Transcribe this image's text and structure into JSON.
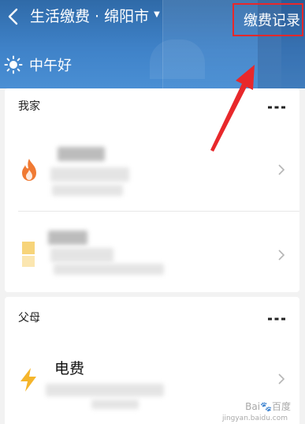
{
  "header": {
    "title": "生活缴费 · 绵阳市",
    "record_label": "缴费记录",
    "greeting": "中午好"
  },
  "groups": [
    {
      "title": "我家",
      "items": [
        {
          "icon": "gas-flame-icon"
        },
        {
          "icon": "water-bill-icon"
        }
      ]
    },
    {
      "title": "父母",
      "items": [
        {
          "icon": "lightning-icon",
          "name": "电费"
        }
      ]
    }
  ],
  "colors": {
    "header": "#3f82c8",
    "highlight_box": "#e8282b",
    "arrow": "#e8282b",
    "flame": "#f07a33",
    "lightning": "#f5b52b",
    "water": "#f7d47a"
  },
  "watermark": "jingyan.baidu.com"
}
